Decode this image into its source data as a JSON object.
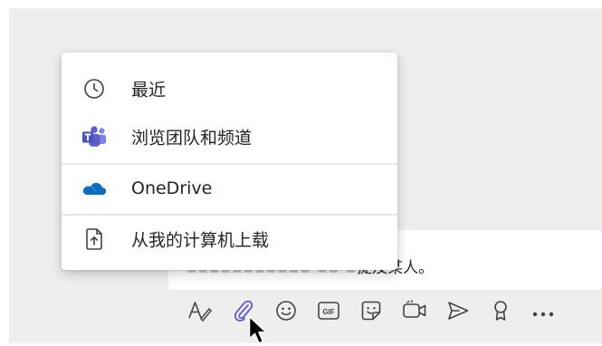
{
  "compose": {
    "hint_visible": "提及某人。"
  },
  "attach_menu": {
    "items": [
      {
        "label": "最近",
        "icon": "clock-icon"
      },
      {
        "label": "浏览团队和频道",
        "icon": "teams-logo-icon"
      },
      {
        "label": "OneDrive",
        "icon": "onedrive-cloud-icon"
      },
      {
        "label": "从我的计算机上载",
        "icon": "upload-file-icon"
      }
    ]
  },
  "toolbar": {
    "buttons": [
      "format-icon",
      "attach-icon",
      "emoji-icon",
      "gif-icon",
      "sticker-icon",
      "meet-now-icon",
      "send-icon",
      "praise-icon",
      "more-icon"
    ],
    "gif_text": "GIF"
  },
  "colors": {
    "background": "#efeeed",
    "teams_purple": "#5b5fc7",
    "onedrive_blue": "#0f6cbd",
    "icon_gray": "#424242"
  }
}
